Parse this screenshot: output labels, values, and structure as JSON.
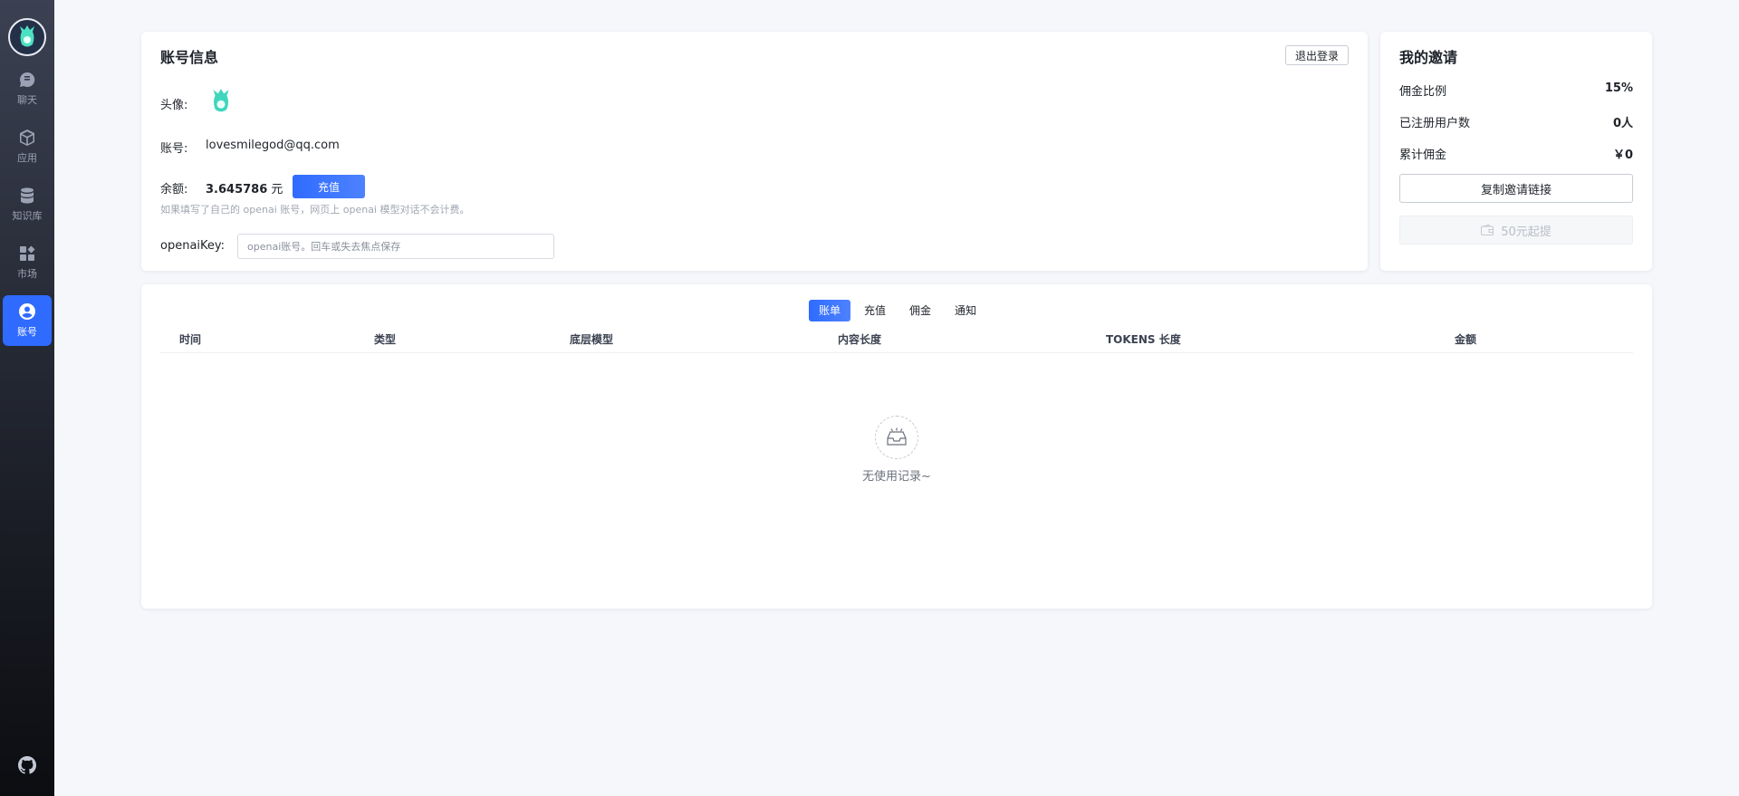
{
  "sidebar": {
    "items": [
      {
        "label": "聊天",
        "icon": "chat-icon"
      },
      {
        "label": "应用",
        "icon": "box-icon"
      },
      {
        "label": "知识库",
        "icon": "database-icon"
      },
      {
        "label": "市场",
        "icon": "apps-icon"
      },
      {
        "label": "账号",
        "icon": "user-icon",
        "active": true
      }
    ]
  },
  "account": {
    "title": "账号信息",
    "logout_label": "退出登录",
    "avatar_label": "头像:",
    "account_label": "账号:",
    "account_value": "lovesmilegod@qq.com",
    "balance_label": "余额:",
    "balance_value": "3.645786",
    "balance_unit": "元",
    "recharge_label": "充值",
    "hint": "如果填写了自己的 openai 账号，网页上 openai 模型对话不会计费。",
    "key_label": "openaiKey:",
    "key_placeholder": "openai账号。回车或失去焦点保存"
  },
  "invite": {
    "title": "我的邀请",
    "commission_rate_label": "佣金比例",
    "commission_rate_value": "15%",
    "registered_label": "已注册用户数",
    "registered_value": "0人",
    "total_commission_label": "累计佣金",
    "total_commission_value": "￥0",
    "copy_link_label": "复制邀请链接",
    "withdraw_label": "50元起提"
  },
  "bills": {
    "tabs": [
      "账单",
      "充值",
      "佣金",
      "通知"
    ],
    "active_tab": 0,
    "columns": [
      "时间",
      "类型",
      "底层模型",
      "内容长度",
      "TOKENS 长度",
      "金额"
    ],
    "empty_text": "无使用记录~"
  },
  "colors": {
    "accent": "#2f6bff",
    "sidebar_bg": "#1d2029"
  }
}
